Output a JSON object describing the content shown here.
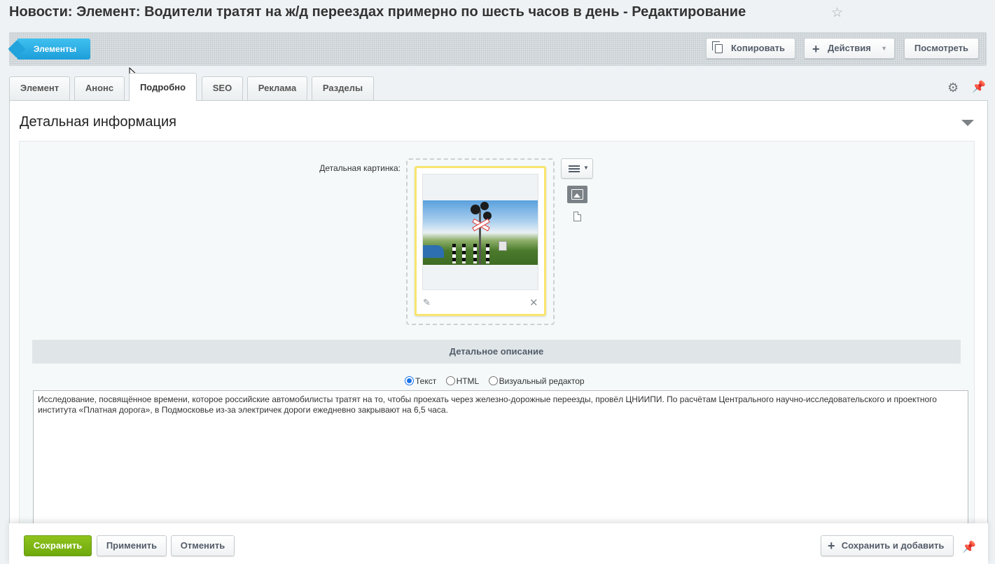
{
  "page": {
    "title": "Новости: Элемент: Водители тратят на ж/д переездах примерно по шесть часов в день - Редактирование"
  },
  "toolbar": {
    "back_label": "Элементы",
    "copy_label": "Копировать",
    "actions_label": "Действия",
    "view_label": "Посмотреть"
  },
  "tabs": [
    {
      "label": "Элемент",
      "active": false
    },
    {
      "label": "Анонс",
      "active": false
    },
    {
      "label": "Подробно",
      "active": true
    },
    {
      "label": "SEO",
      "active": false
    },
    {
      "label": "Реклама",
      "active": false
    },
    {
      "label": "Разделы",
      "active": false
    }
  ],
  "section": {
    "title": "Детальная информация",
    "image_label": "Детальная картинка:",
    "description_header": "Детальное описание"
  },
  "editor_modes": {
    "selected": "Текст",
    "options": [
      "Текст",
      "HTML",
      "Визуальный редактор"
    ]
  },
  "description_text": "Исследование, посвящённое времени, которое российские автомобилисты тратят на то, чтобы проехать через железно-дорожные переезды, провёл ЦНИИПИ. По расчётам Центрального научно-исследовательского и проектного института «Платная дорога», в Подмосковье из-за электричек дороги ежедневно закрывают на 6,5 часа.",
  "footer": {
    "save_label": "Сохранить",
    "apply_label": "Применить",
    "cancel_label": "Отменить",
    "save_add_label": "Сохранить и добавить"
  },
  "icons": {
    "favorite": "star-icon",
    "settings": "gear-icon",
    "pin": "pin-icon",
    "copy": "copy-icon",
    "add": "plus-icon"
  },
  "colors": {
    "accent_blue": "#1e9ed9",
    "save_green": "#7bb20f",
    "image_highlight": "#f9e56e"
  }
}
